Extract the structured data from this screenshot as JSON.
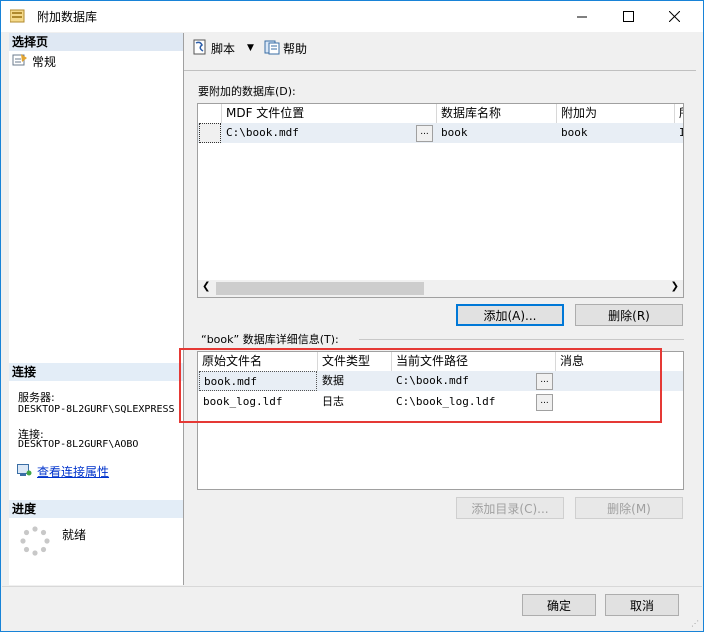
{
  "window": {
    "title": "附加数据库"
  },
  "left": {
    "select_page_header": "选择页",
    "page_general": "常规",
    "connection_header": "连接",
    "server_label": "服务器:",
    "server_value": "DESKTOP-8L2GURF\\SQLEXPRESS",
    "connection_label": "连接:",
    "connection_value": "DESKTOP-8L2GURF\\AOBO",
    "view_props_link": "查看连接属性",
    "progress_header": "进度",
    "progress_status": "就绪"
  },
  "toolbar": {
    "script": "脚本",
    "help": "帮助"
  },
  "attach": {
    "label": "要附加的数据库(D):",
    "columns": [
      "MDF 文件位置",
      "数据库名称",
      "附加为",
      "所"
    ],
    "rows": [
      {
        "mdf": "C:\\book.mdf",
        "dbname": "book",
        "attach_as": "book",
        "extra": "I"
      }
    ],
    "ellipsis": "...",
    "add_button": "添加(A)...",
    "remove_button": "删除(R)"
  },
  "details": {
    "label": "“book” 数据库详细信息(T):",
    "columns": [
      "原始文件名",
      "文件类型",
      "当前文件路径",
      "消息"
    ],
    "rows": [
      {
        "name": "book.mdf",
        "type": "数据",
        "path": "C:\\book.mdf",
        "msg": ""
      },
      {
        "name": "book_log.ldf",
        "type": "日志",
        "path": "C:\\book_log.ldf",
        "msg": ""
      }
    ],
    "ellipsis": "...",
    "add_catalog_button": "添加目录(C)...",
    "remove_button": "删除(M)"
  },
  "footer": {
    "ok": "确定",
    "cancel": "取消"
  },
  "colors": {
    "highlight_box": "#e53935",
    "focus": "#0078d7",
    "link": "#0033cc"
  }
}
